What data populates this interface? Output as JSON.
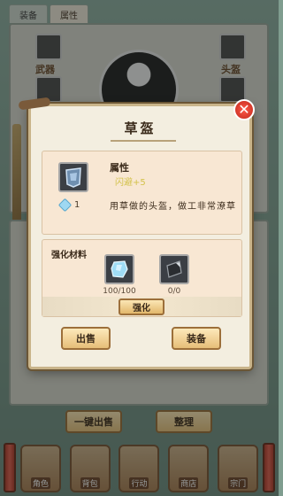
{
  "tabs": [
    {
      "label": "装备"
    },
    {
      "label": "属性"
    }
  ],
  "equipment": {
    "slot_left_label": "武器",
    "slot_right_label": "头盔"
  },
  "bag": {
    "sell_all_label": "一键出售",
    "sort_label": "整理"
  },
  "bottom_nav": [
    {
      "label": "角色",
      "icon": "character-icon"
    },
    {
      "label": "背包",
      "icon": "bag-icon"
    },
    {
      "label": "行动",
      "icon": "adventure-icon"
    },
    {
      "label": "商店",
      "icon": "shop-icon"
    },
    {
      "label": "宗门",
      "icon": "sect-icon"
    }
  ],
  "dialog": {
    "title": "草盔",
    "attr_title": "属性",
    "attr_value": "闪避+5",
    "gem_count": "1",
    "description": "用草做的头盔，做工非常潦草",
    "materials_title": "强化材料",
    "materials": [
      {
        "icon": "crystal-icon",
        "count": "100/100"
      },
      {
        "icon": "iron-icon",
        "count": "0/0"
      }
    ],
    "enhance_label": "强化",
    "sell_label": "出售",
    "equip_label": "装备"
  },
  "colors": {
    "accent": "#e2b76b",
    "close": "#c0281c",
    "attr_value": "#d3c24a"
  }
}
